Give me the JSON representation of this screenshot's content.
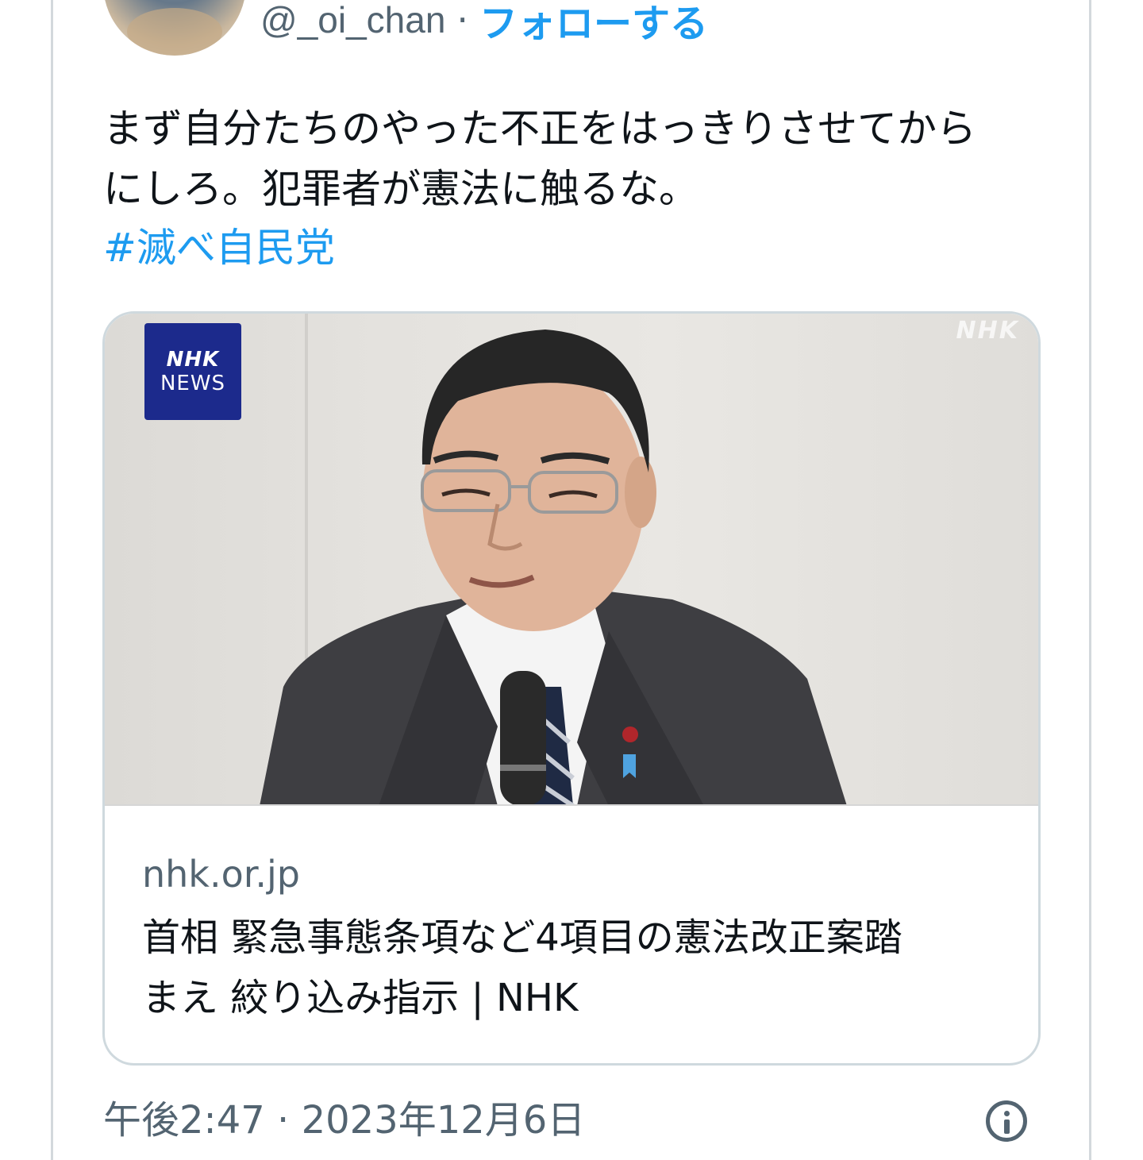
{
  "header": {
    "handle": "@_oi_chan",
    "separator": "·",
    "follow_label": "フォローする"
  },
  "tweet": {
    "text_line1": "まず自分たちのやった不正をはっきりさせてから",
    "text_line2": "にしろ。犯罪者が憲法に触るな。",
    "hashtag": "#滅べ自民党"
  },
  "card": {
    "logo_line1": "NHK",
    "logo_line2": "NEWS",
    "watermark": "NHK",
    "domain": "nhk.or.jp",
    "title_line1": "首相 緊急事態条項など4項目の憲法改正案踏",
    "title_line2": "まえ 絞り込み指示 | NHK"
  },
  "footer": {
    "timestamp": "午後2:47 · 2023年12月6日"
  },
  "colors": {
    "accent": "#1d9bf0",
    "secondary_text": "#536471",
    "nhk_blue": "#1c2a8c"
  }
}
